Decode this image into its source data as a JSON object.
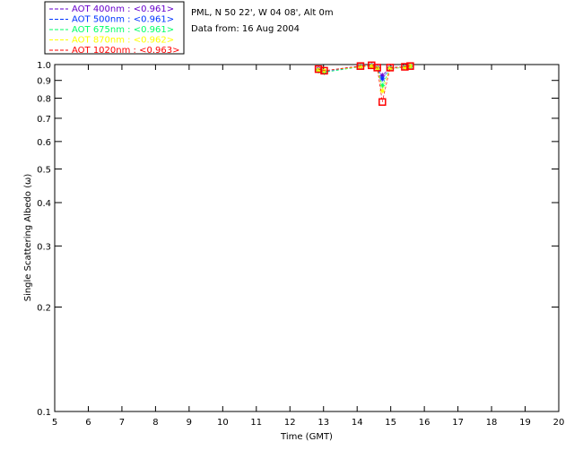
{
  "header": {
    "site": "PML, N 50 22', W 04 08', Alt 0m",
    "date": "Data from: 16 Aug 2004"
  },
  "chart_data": {
    "type": "scatter",
    "xlabel": "Time (GMT)",
    "ylabel": "Single Scattering Albedo (ω)",
    "xlim": [
      5,
      20
    ],
    "ylim": [
      0.1,
      1.0
    ],
    "yscale": "log",
    "xticks": [
      "5",
      "6",
      "7",
      "8",
      "9",
      "10",
      "11",
      "12",
      "13",
      "14",
      "15",
      "16",
      "17",
      "18",
      "19",
      "20"
    ],
    "yticks": [
      {
        "v": 0.1,
        "l": "0.1"
      },
      {
        "v": 0.2,
        "l": "0.2"
      },
      {
        "v": 0.3,
        "l": "0.3"
      },
      {
        "v": 0.4,
        "l": "0.4"
      },
      {
        "v": 0.5,
        "l": "0.5"
      },
      {
        "v": 0.6,
        "l": "0.6"
      },
      {
        "v": 0.7,
        "l": "0.7"
      },
      {
        "v": 0.8,
        "l": "0.8"
      },
      {
        "v": 0.9,
        "l": "0.9"
      },
      {
        "v": 1.0,
        "l": "1.0"
      }
    ],
    "legend_position": "top-left outside",
    "x": [
      12.85,
      13.02,
      14.1,
      14.43,
      14.6,
      14.75,
      14.98,
      15.42,
      15.58
    ],
    "series": [
      {
        "name": "AOT  400nm : <0.961>",
        "color": "#6600cc",
        "values": [
          0.97,
          0.96,
          0.99,
          0.995,
          0.98,
          0.93,
          0.98,
          0.985,
          0.99
        ]
      },
      {
        "name": "AOT  500nm : <0.961>",
        "color": "#0033ff",
        "values": [
          0.965,
          0.955,
          0.985,
          0.99,
          0.975,
          0.91,
          0.975,
          0.98,
          0.99
        ]
      },
      {
        "name": "AOT  675nm : <0.961>",
        "color": "#00ff66",
        "values": [
          0.96,
          0.95,
          0.985,
          0.99,
          0.975,
          0.87,
          0.975,
          0.98,
          0.985
        ]
      },
      {
        "name": "AOT  870nm : <0.962>",
        "color": "#ffff00",
        "values": [
          0.965,
          0.96,
          0.985,
          0.99,
          0.975,
          0.84,
          0.975,
          0.98,
          0.99
        ]
      },
      {
        "name": "AOT 1020nm : <0.963>",
        "color": "#ff0000",
        "values": [
          0.97,
          0.96,
          0.99,
          0.995,
          0.98,
          0.78,
          0.98,
          0.985,
          0.99
        ]
      }
    ]
  }
}
